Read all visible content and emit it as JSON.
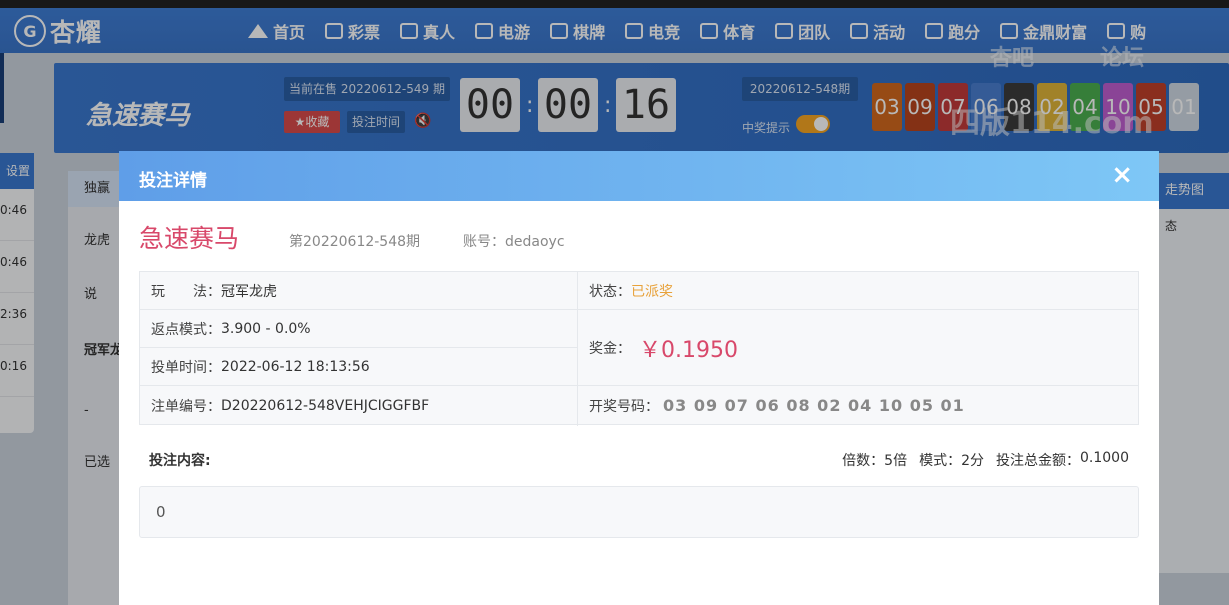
{
  "nav": {
    "brand": "杏耀",
    "brand_mark": "G",
    "items": [
      {
        "label": "首页",
        "icon": "home-icon"
      },
      {
        "label": "彩票",
        "icon": "lottery-icon"
      },
      {
        "label": "真人",
        "icon": "live-casino-icon"
      },
      {
        "label": "电游",
        "icon": "slot-icon"
      },
      {
        "label": "棋牌",
        "icon": "card-icon"
      },
      {
        "label": "电竞",
        "icon": "gamepad-icon"
      },
      {
        "label": "体育",
        "icon": "trophy-icon"
      },
      {
        "label": "团队",
        "icon": "team-icon"
      },
      {
        "label": "活动",
        "icon": "gift-icon"
      },
      {
        "label": "跑分",
        "icon": "car-icon"
      },
      {
        "label": "金鼎财富",
        "icon": "wealth-icon"
      },
      {
        "label": "购",
        "icon": "shop-icon"
      }
    ]
  },
  "game": {
    "title": "急速赛马",
    "current_issue": "当前在售 20220612-549 期",
    "fav_label": "★收藏",
    "bet_time_label": "投注时间",
    "countdown": [
      "00",
      "00",
      "16"
    ],
    "last_issue": "20220612-548期",
    "win_tip_label": "中奖提示",
    "draw_balls": [
      {
        "n": "03",
        "color": "#d2691e"
      },
      {
        "n": "09",
        "color": "#b8451e"
      },
      {
        "n": "07",
        "color": "#c23b3b"
      },
      {
        "n": "06",
        "color": "#4a7fd0"
      },
      {
        "n": "08",
        "color": "#3c3c3c"
      },
      {
        "n": "02",
        "color": "#e0b53a"
      },
      {
        "n": "04",
        "color": "#4caf50"
      },
      {
        "n": "10",
        "color": "#c05fd0"
      },
      {
        "n": "05",
        "color": "#c0402a"
      },
      {
        "n": "01",
        "color": "#cfd8e3"
      }
    ]
  },
  "left_panel": {
    "header": "设置",
    "rows": [
      "0:46",
      "0:46",
      "2:36",
      "0:16"
    ]
  },
  "mid_panel": {
    "tab": "独赢",
    "row1": "龙虎",
    "notice": "说",
    "section": "冠军龙",
    "minus": "-",
    "selected_label": "已选"
  },
  "right_panel": {
    "header": "走势图",
    "status": "态"
  },
  "modal": {
    "title": "投注详情",
    "close_glyph": "×",
    "lottery_name": "急速赛马",
    "issue": "第20220612-548期",
    "account_label": "账号：",
    "account_value": "dedaoyc",
    "play_label": "玩　　法：",
    "play_value": "冠军龙虎",
    "status_label": "状态：",
    "status_value": "已派奖",
    "rebate_label": "返点模式：",
    "rebate_value": "3.900 - 0.0%",
    "bet_time_label": "投单时间：",
    "bet_time_value": "2022-06-12 18:13:56",
    "prize_label": "奖金：",
    "prize_value": "￥0.1950",
    "order_label": "注单编号：",
    "order_value": "D20220612-548VEHJCIGGFBF",
    "draw_label": "开奖号码：",
    "draw_value": "03 09 07 06 08 02 04 10 05 01",
    "content_label": "投注内容:",
    "multiple_label": "倍数：",
    "multiple_value": "5倍",
    "mode_label": "模式：",
    "mode_value": "2分",
    "total_label": "投注总金额：",
    "total_value": "0.1000",
    "content_value": "0"
  },
  "watermark": {
    "line1": "杏吧",
    "line2": "论坛",
    "line3": "四版114.com"
  }
}
